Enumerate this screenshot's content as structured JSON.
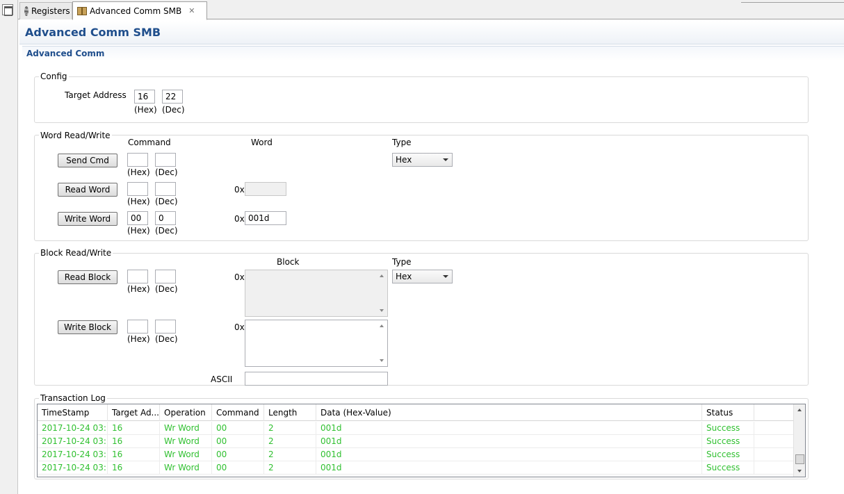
{
  "tabs": [
    {
      "label": "Registers",
      "icon": "gear-icon"
    },
    {
      "label": "Advanced Comm SMB",
      "icon": "package-icon"
    }
  ],
  "page_title": "Advanced Comm SMB",
  "section_title": "Advanced Comm",
  "config": {
    "title": "Config",
    "target_address_label": "Target Address",
    "target_hex": "16",
    "target_dec": "22",
    "hex_hint": "(Hex)",
    "dec_hint": "(Dec)"
  },
  "word": {
    "title": "Word Read/Write",
    "command_header": "Command",
    "word_header": "Word",
    "type_header": "Type",
    "type_value": "Hex",
    "send_cmd_label": "Send Cmd",
    "read_word_label": "Read Word",
    "write_word_label": "Write Word",
    "prefix": "0x",
    "send_cmd_hex": "",
    "send_cmd_dec": "",
    "read_cmd_hex": "",
    "read_cmd_dec": "",
    "read_value": "",
    "write_cmd_hex": "00",
    "write_cmd_dec": "0",
    "write_value": "001d",
    "hex_hint": "(Hex)",
    "dec_hint": "(Dec)"
  },
  "block": {
    "title": "Block Read/Write",
    "block_header": "Block",
    "type_header": "Type",
    "type_value": "Hex",
    "read_block_label": "Read Block",
    "write_block_label": "Write Block",
    "prefix": "0x",
    "ascii_label": "ASCII",
    "hex_hint": "(Hex)",
    "dec_hint": "(Dec)"
  },
  "log": {
    "title": "Transaction Log",
    "columns": [
      "TimeStamp",
      "Target Ad...",
      "Operation",
      "Command",
      "Length",
      "Data (Hex-Value)",
      "Status"
    ],
    "rows": [
      [
        "2017-10-24 03:...",
        "16",
        "Wr Word",
        "00",
        "2",
        "001d",
        "Success"
      ],
      [
        "2017-10-24 03:...",
        "16",
        "Wr Word",
        "00",
        "2",
        "001d",
        "Success"
      ],
      [
        "2017-10-24 03:...",
        "16",
        "Wr Word",
        "00",
        "2",
        "001d",
        "Success"
      ],
      [
        "2017-10-24 03:...",
        "16",
        "Wr Word",
        "00",
        "2",
        "001d",
        "Success"
      ]
    ],
    "row_color": "#30c030"
  }
}
